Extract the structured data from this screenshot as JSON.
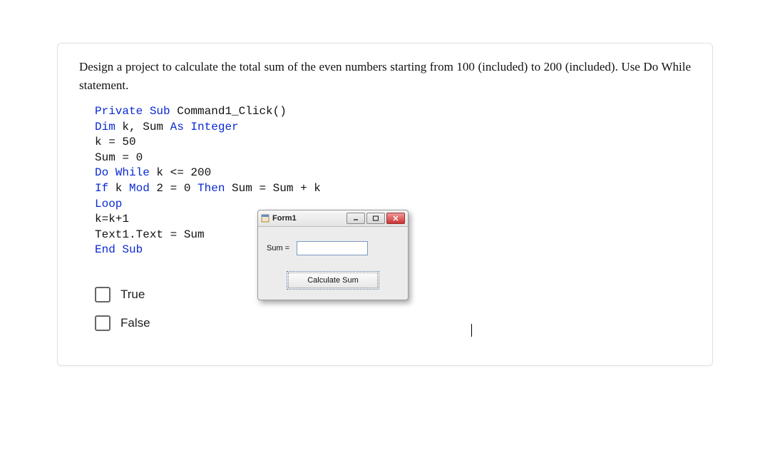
{
  "question": "Design a project to calculate the total sum of the even numbers starting from 100 (included) to 200 (included). Use Do While statement.",
  "code": {
    "l1a": "Private Sub",
    "l1b": " Command1_Click()",
    "l2a": "Dim",
    "l2b": " k, Sum ",
    "l2c": "As Integer",
    "l3": "k = 50",
    "l4": "Sum = 0",
    "l5a": "Do While",
    "l5b": " k <= 200",
    "l6a": "If",
    "l6b": " k ",
    "l6c": "Mod",
    "l6d": " 2 = 0 ",
    "l6e": "Then",
    "l6f": " Sum = Sum + k",
    "l7": "Loop",
    "l8": "k=k+1",
    "l9": "Text1.Text = Sum",
    "l10": "End Sub"
  },
  "form": {
    "title": "Form1",
    "min": "—",
    "max": "▣",
    "close": "✕",
    "sum_label": "Sum =",
    "sum_value": "",
    "button": "Calculate Sum"
  },
  "answers": {
    "a": "True",
    "b": "False"
  }
}
